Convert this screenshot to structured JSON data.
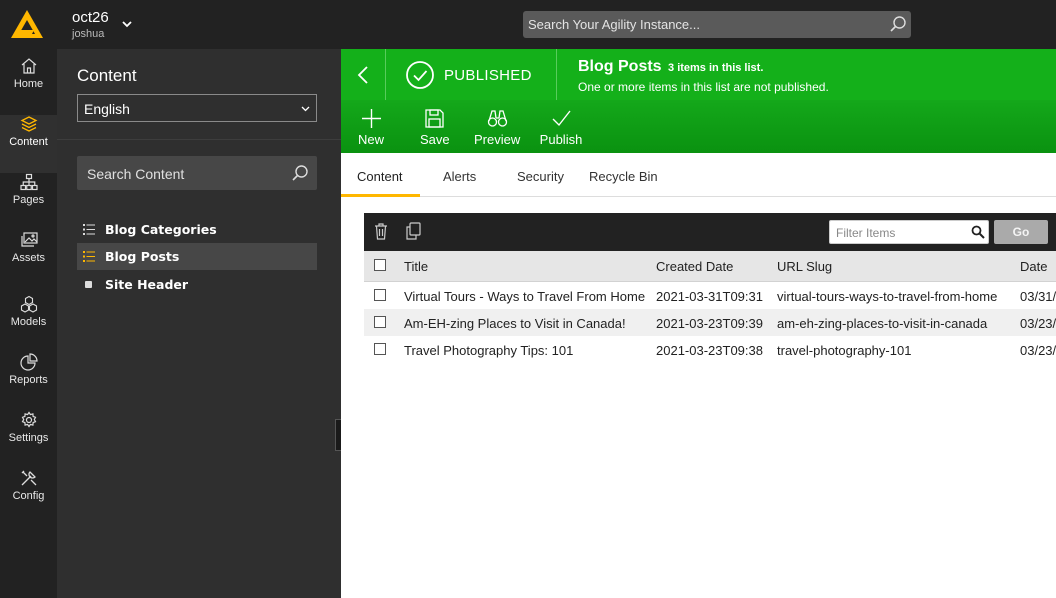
{
  "colors": {
    "brand": "#ffb700",
    "published_green": "#14b01a",
    "dark_chrome": "#222222"
  },
  "topbar": {
    "instance_name": "oct26",
    "user_name": "joshua",
    "search_placeholder": "Search Your Agility Instance..."
  },
  "leftnav": {
    "items": [
      {
        "label": "Home",
        "icon": "home-icon"
      },
      {
        "label": "Content",
        "icon": "content-layers-icon",
        "active": true
      },
      {
        "label": "Pages",
        "icon": "pages-sitemap-icon"
      },
      {
        "label": "Assets",
        "icon": "assets-images-icon"
      },
      {
        "label": "Models",
        "icon": "models-cubes-icon"
      },
      {
        "label": "Reports",
        "icon": "reports-pie-icon"
      },
      {
        "label": "Settings",
        "icon": "gear-icon"
      },
      {
        "label": "Config",
        "icon": "tools-icon"
      }
    ]
  },
  "panel": {
    "title": "Content",
    "language": "English",
    "search_placeholder": "Search Content",
    "tree": [
      {
        "label": "Blog Categories",
        "icon": "list-icon"
      },
      {
        "label": "Blog Posts",
        "icon": "list-icon",
        "active": true
      },
      {
        "label": "Site Header",
        "icon": "square-icon"
      }
    ]
  },
  "header": {
    "status": "PUBLISHED",
    "list_title": "Blog Posts",
    "item_count_text": "3 items in this list.",
    "subtitle": "One or more items in this list are not published."
  },
  "toolbar": {
    "new_label": "New",
    "save_label": "Save",
    "preview_label": "Preview",
    "publish_label": "Publish"
  },
  "tabs": [
    "Content",
    "Alerts",
    "Security",
    "Recycle Bin"
  ],
  "grid": {
    "filter_placeholder": "Filter Items",
    "go_label": "Go",
    "columns": [
      "Title",
      "Created Date",
      "URL Slug",
      "Date"
    ],
    "rows": [
      {
        "title": "Virtual Tours - Ways to Travel From Home",
        "created": "2021-03-31T09:31",
        "slug": "virtual-tours-ways-to-travel-from-home",
        "date": "03/31/"
      },
      {
        "title": "Am-EH-zing Places to Visit in Canada!",
        "created": "2021-03-23T09:39",
        "slug": "am-eh-zing-places-to-visit-in-canada",
        "date": "03/23/"
      },
      {
        "title": "Travel Photography Tips: 101",
        "created": "2021-03-23T09:38",
        "slug": "travel-photography-101",
        "date": "03/23/"
      }
    ]
  }
}
